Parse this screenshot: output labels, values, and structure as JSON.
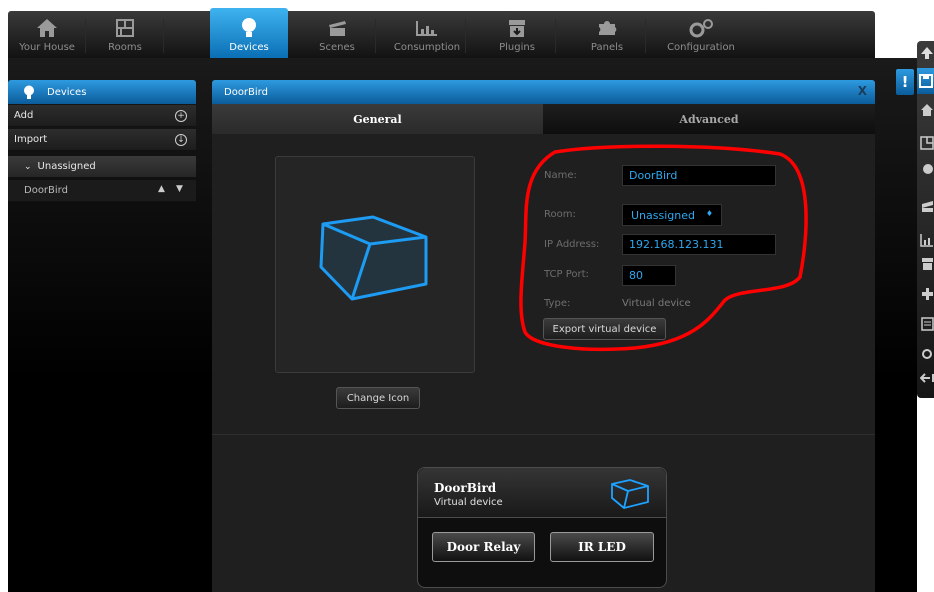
{
  "nav": {
    "tabs": [
      {
        "label": "Your House",
        "icon": "house-icon"
      },
      {
        "label": "Rooms",
        "icon": "rooms-icon"
      },
      {
        "label": "Devices",
        "icon": "lightbulb-icon",
        "active": true
      },
      {
        "label": "Scenes",
        "icon": "clapperboard-icon"
      },
      {
        "label": "Consumption",
        "icon": "bar-chart-icon"
      },
      {
        "label": "Plugins",
        "icon": "plugin-box-icon"
      },
      {
        "label": "Panels",
        "icon": "puzzle-icon"
      },
      {
        "label": "Configuration",
        "icon": "gears-icon"
      }
    ]
  },
  "sidebar": {
    "title": "Devices",
    "add_label": "Add",
    "import_label": "Import",
    "group_label": "Unassigned",
    "device_label": "DoorBird"
  },
  "panel": {
    "title": "DoorBird",
    "close_label": "X",
    "tabs": {
      "general": "General",
      "advanced": "Advanced"
    },
    "change_icon_label": "Change Icon",
    "form": {
      "name_label": "Name:",
      "name_value": "DoorBird",
      "room_label": "Room:",
      "room_value": "Unassigned",
      "ip_label": "IP Address:",
      "ip_value": "192.168.123.131",
      "port_label": "TCP Port:",
      "port_value": "80",
      "type_label": "Type:",
      "type_value": "Virtual device",
      "export_label": "Export virtual device"
    }
  },
  "preview": {
    "title": "DoorBird",
    "subtitle": "Virtual device",
    "buttons": [
      "Door Relay",
      "IR LED"
    ]
  },
  "quickbar": {
    "alert_label": "!"
  },
  "colors": {
    "accent": "#1c8fd6",
    "input_text": "#2ea8ef",
    "annotation": "#ff0000"
  }
}
